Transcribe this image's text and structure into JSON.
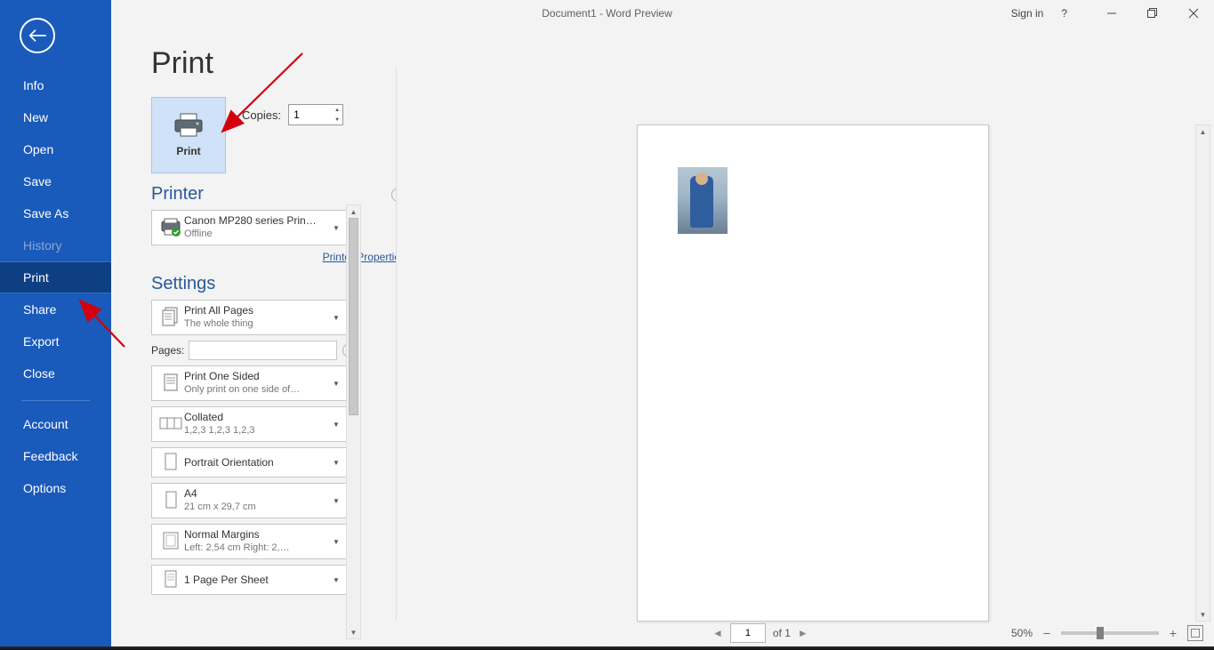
{
  "title": "Document1  -  Word Preview",
  "signIn": "Sign in",
  "help": "?",
  "sidebar": {
    "items": [
      "Info",
      "New",
      "Open",
      "Save",
      "Save As",
      "History",
      "Print",
      "Share",
      "Export",
      "Close"
    ],
    "items2": [
      "Account",
      "Feedback",
      "Options"
    ]
  },
  "header": "Print",
  "printBtnLabel": "Print",
  "copies": {
    "label": "Copies:",
    "value": "1"
  },
  "printer": {
    "title": "Printer",
    "name": "Canon MP280 series Prin…",
    "status": "Offline",
    "propsLink": "Printer Properties"
  },
  "settings": {
    "title": "Settings",
    "printWhat": {
      "l1": "Print All Pages",
      "l2": "The whole thing"
    },
    "pagesLabel": "Pages:",
    "pagesValue": "",
    "sided": {
      "l1": "Print One Sided",
      "l2": "Only print on one side of…"
    },
    "collate": {
      "l1": "Collated",
      "l2": "1,2,3    1,2,3    1,2,3"
    },
    "orient": {
      "l1": "Portrait Orientation"
    },
    "paper": {
      "l1": "A4",
      "l2": "21 cm x 29,7 cm"
    },
    "margins": {
      "l1": "Normal Margins",
      "l2": "Left:  2,54 cm    Right:  2,…"
    },
    "perSheet": {
      "l1": "1 Page Per Sheet"
    }
  },
  "preview": {
    "curPage": "1",
    "ofText": "of 1",
    "zoom": "50%"
  }
}
